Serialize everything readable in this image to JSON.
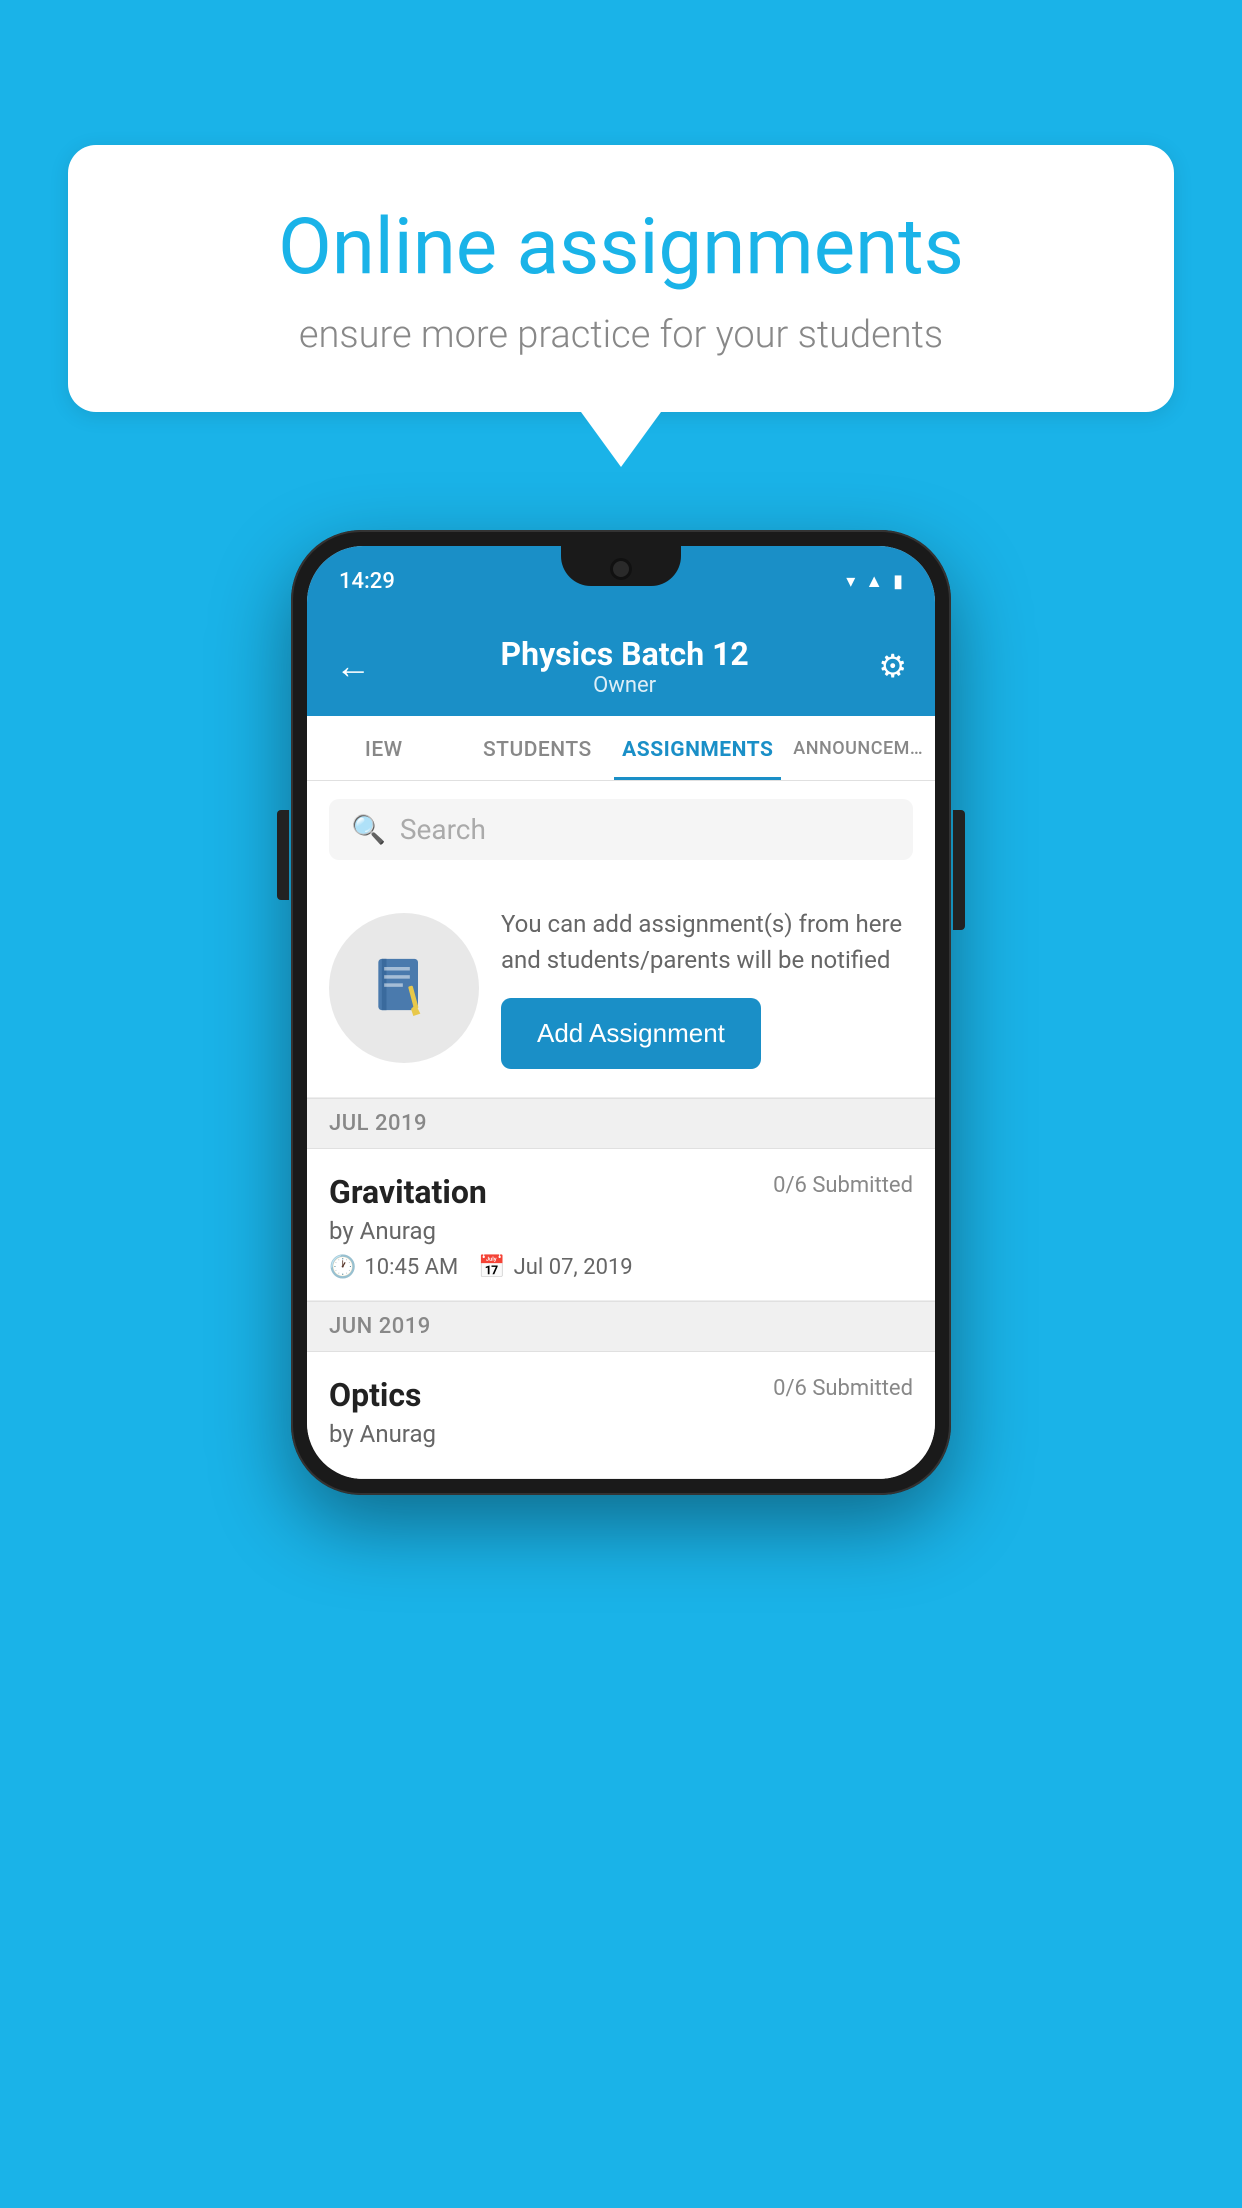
{
  "background": {
    "color": "#1ab3e8"
  },
  "speech_bubble": {
    "title": "Online assignments",
    "subtitle": "ensure more practice for your students"
  },
  "status_bar": {
    "time": "14:29",
    "wifi_icon": "▼",
    "signal_icon": "▲",
    "battery_icon": "▮"
  },
  "app_header": {
    "title": "Physics Batch 12",
    "subtitle": "Owner",
    "back_label": "←",
    "settings_label": "⚙"
  },
  "tabs": [
    {
      "label": "IEW",
      "active": false
    },
    {
      "label": "STUDENTS",
      "active": false
    },
    {
      "label": "ASSIGNMENTS",
      "active": true
    },
    {
      "label": "ANNOUNCEM...",
      "active": false
    }
  ],
  "search": {
    "placeholder": "Search"
  },
  "promo": {
    "description": "You can add assignment(s) from here and students/parents will be notified",
    "button_label": "Add Assignment"
  },
  "sections": [
    {
      "label": "JUL 2019",
      "assignments": [
        {
          "title": "Gravitation",
          "status": "0/6 Submitted",
          "author": "by Anurag",
          "time": "10:45 AM",
          "date": "Jul 07, 2019"
        }
      ]
    },
    {
      "label": "JUN 2019",
      "assignments": [
        {
          "title": "Optics",
          "status": "0/6 Submitted",
          "author": "by Anurag",
          "time": "",
          "date": ""
        }
      ]
    }
  ]
}
